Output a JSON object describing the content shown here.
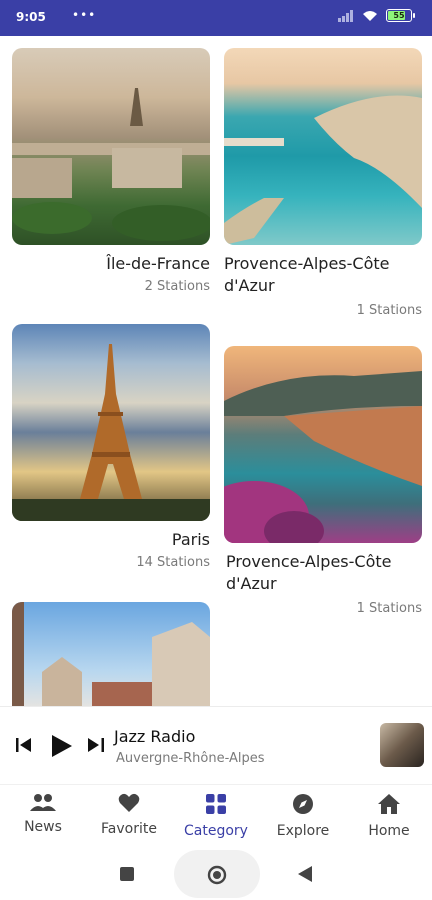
{
  "status": {
    "time": "9:05",
    "dots": "•••",
    "battery": "55"
  },
  "cards": [
    {
      "title": "Île-de-France",
      "sub": "2 Stations"
    },
    {
      "title": "Provence-Alpes-Côte d'Azur",
      "sub": "1 Stations"
    },
    {
      "title": "Paris",
      "sub": "14 Stations"
    },
    {
      "title": "Provence-Alpes-Côte d'Azur",
      "sub": "1 Stations"
    }
  ],
  "player": {
    "station": "Jazz Radio",
    "region": "Auvergne-Rhône-Alpes"
  },
  "nav": [
    {
      "label": "News",
      "icon": "people-icon"
    },
    {
      "label": "Favorite",
      "icon": "heart-icon"
    },
    {
      "label": "Category",
      "icon": "grid-icon"
    },
    {
      "label": "Explore",
      "icon": "compass-icon"
    },
    {
      "label": "Home",
      "icon": "home-icon"
    }
  ],
  "colors": {
    "accent": "#3a3fa6",
    "status_bar": "#3a3fa6"
  }
}
